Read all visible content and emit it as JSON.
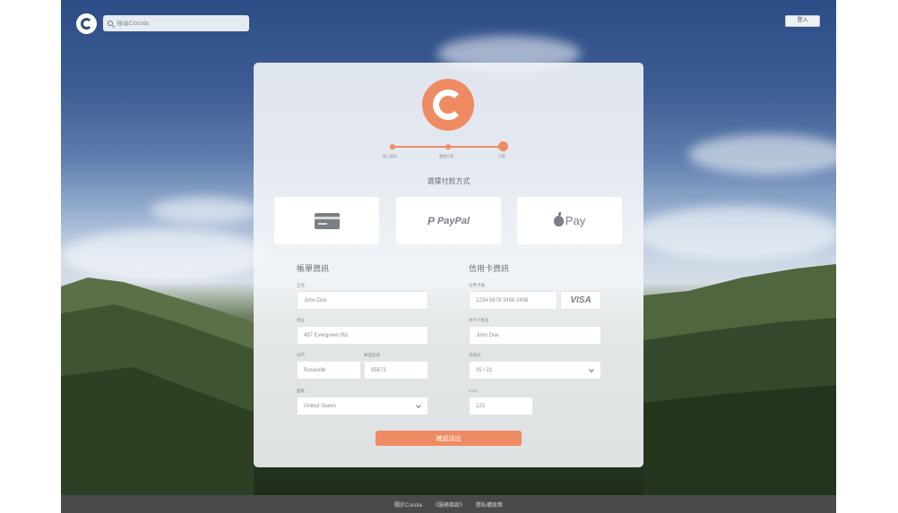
{
  "header": {
    "search_placeholder": "搜尋Cocola",
    "login_label": "登入"
  },
  "stepper": {
    "steps": [
      "個人資訊",
      "選擇方案",
      "付款"
    ]
  },
  "payment": {
    "title": "選擇付款方式",
    "paypal_label": "PayPal",
    "applepay_label": "Pay"
  },
  "billing": {
    "title": "帳單資訊",
    "name_label": "全名",
    "name_value": "John Doe",
    "address_label": "地址",
    "address_value": "497 Evergreen Rd.",
    "city_label": "城市",
    "city_value": "Roseville",
    "zip_label": "郵遞區號",
    "zip_value": "95673",
    "country_label": "國家",
    "country_value": "United States"
  },
  "credit": {
    "title": "信用卡資訊",
    "card_label": "信用卡號",
    "card_value": "1234  5678  3456  2456",
    "brand": "VISA",
    "holder_label": "持卡人姓名",
    "holder_value": "John Doe",
    "expiry_label": "到期日",
    "expiry_value": "05  /  21",
    "cvv_label": "CVV",
    "cvv_value": "123"
  },
  "submit_label": "確認送出",
  "footer": {
    "links": [
      "關於Cocola",
      "《服務條款》",
      "隱私權政策"
    ]
  },
  "colors": {
    "accent": "#ef8b63",
    "footer_bg": "#4a4a4a"
  }
}
